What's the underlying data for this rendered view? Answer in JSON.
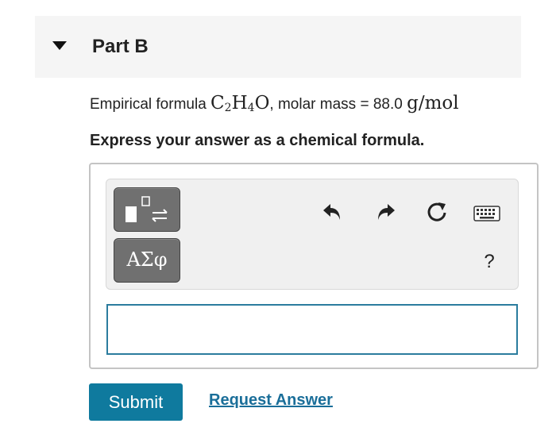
{
  "part": {
    "title": "Part B"
  },
  "question": {
    "prefix": "Empirical formula ",
    "formula_c": "C",
    "formula_c_sub": "2",
    "formula_h": "H",
    "formula_h_sub": "4",
    "formula_o": "O",
    "separator": ", molar mass = ",
    "molar_mass_value": "88.0",
    "molar_mass_unit": "g/mol",
    "instruction": "Express your answer as a chemical formula."
  },
  "toolbar": {
    "symbols_label": "ΑΣφ",
    "help_label": "?",
    "icons": [
      "templates-icon",
      "undo-icon",
      "redo-icon",
      "reset-icon",
      "keyboard-icon"
    ]
  },
  "answer": {
    "value": "",
    "border_color": "#2b7c9e"
  },
  "actions": {
    "submit_label": "Submit",
    "request_label": "Request Answer",
    "submit_color": "#0f7a9e",
    "link_color": "#1a6e99"
  }
}
